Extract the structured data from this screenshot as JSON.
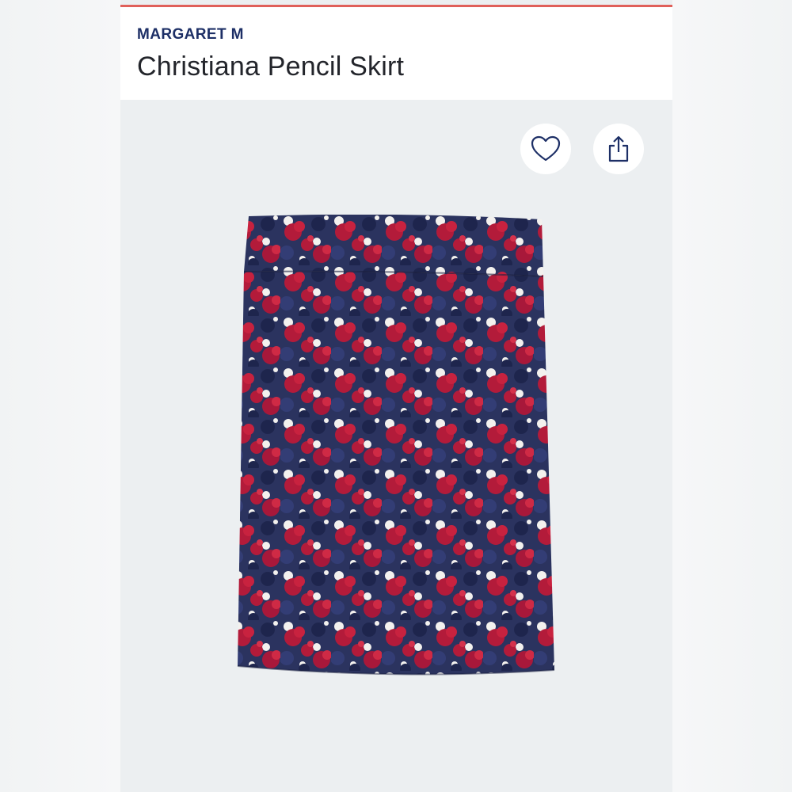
{
  "product": {
    "brand": "MARGARET M",
    "name": "Christiana Pencil Skirt"
  },
  "actions": {
    "favorite_icon": "heart-outline-icon",
    "share_icon": "share-icon"
  },
  "image": {
    "subject": "skirt-image",
    "palette": {
      "navy": "#27305c",
      "red": "#b31b3a",
      "white": "#f3f1ee"
    }
  },
  "colors": {
    "accent_rule": "#e0605a",
    "brand_text": "#1d2f66",
    "title_text": "#23252b",
    "image_bg": "#eceff1"
  }
}
